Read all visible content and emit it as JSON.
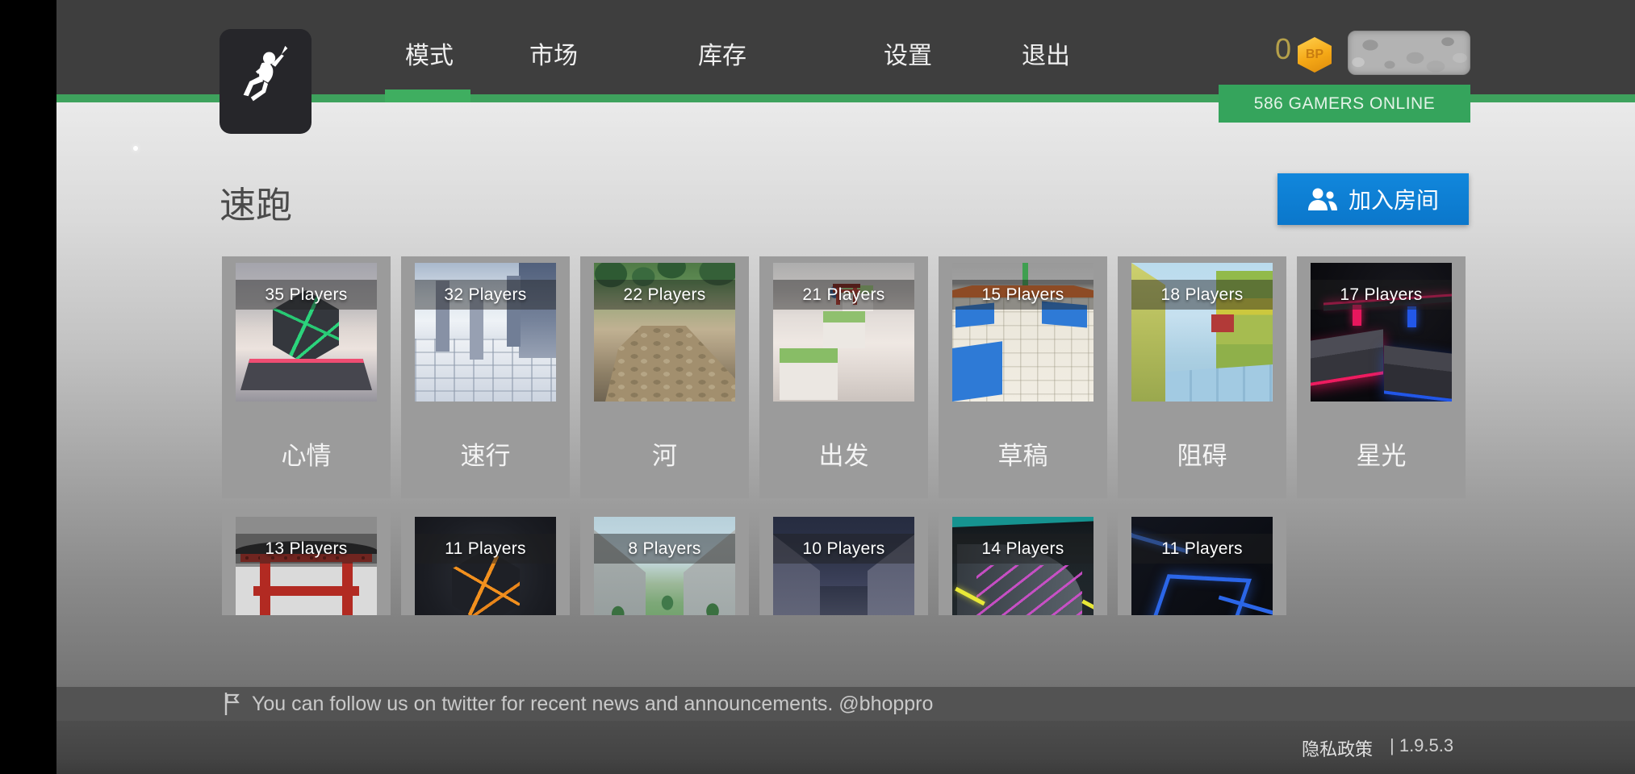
{
  "nav": {
    "items": [
      {
        "label": "模式",
        "active": true
      },
      {
        "label": "市场",
        "active": false
      },
      {
        "label": "库存",
        "active": false
      },
      {
        "label": "设置",
        "active": false
      },
      {
        "label": "退出",
        "active": false
      }
    ],
    "coin_count": "0",
    "coin_badge": "BP",
    "online_badge": "586 GAMERS ONLINE"
  },
  "page": {
    "title": "速跑",
    "join_button": "加入房间"
  },
  "rows": [
    {
      "cards": [
        {
          "players": "35 Players",
          "name": "心情",
          "thumb": "hex-cube-green-clouds"
        },
        {
          "players": "32 Players",
          "name": "速行",
          "thumb": "pillars-tiled-floor"
        },
        {
          "players": "22 Players",
          "name": "河",
          "thumb": "river-jungle-path"
        },
        {
          "players": "21 Players",
          "name": "出发",
          "thumb": "grass-blocks-torii-clouds"
        },
        {
          "players": "15 Players",
          "name": "草稿",
          "thumb": "draft-tiles-blue-patches"
        },
        {
          "players": "18 Players",
          "name": "阻碍",
          "thumb": "obstacle-color-blocks"
        },
        {
          "players": "17 Players",
          "name": "星光",
          "thumb": "neon-red-blue-platforms"
        }
      ]
    },
    {
      "cards": [
        {
          "players": "13 Players",
          "thumb": "red-torii-gate"
        },
        {
          "players": "11 Players",
          "thumb": "hex-cube-orange"
        },
        {
          "players": "8 Players",
          "thumb": "concrete-walls-garden"
        },
        {
          "players": "10 Players",
          "thumb": "night-stone-corridor"
        },
        {
          "players": "14 Players",
          "thumb": "neon-magenta-ramp"
        },
        {
          "players": "11 Players",
          "thumb": "neon-blue-squares"
        }
      ]
    }
  ],
  "footer": {
    "announcement": "You can follow us on twitter for recent news and announcements. @bhoppro",
    "privacy": "隐私政策",
    "version": "| 1.9.5.3"
  }
}
